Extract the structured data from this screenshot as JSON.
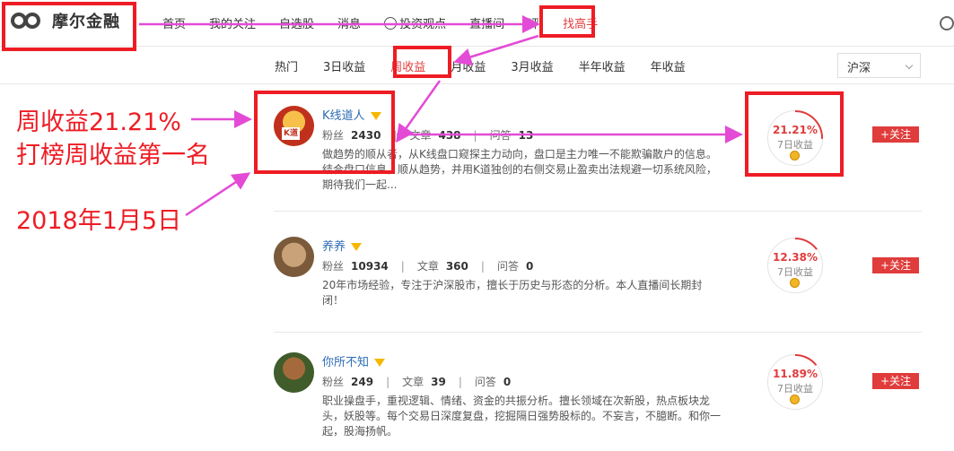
{
  "header": {
    "logo_text": "摩尔金融",
    "nav": [
      {
        "label": "首页"
      },
      {
        "label": "我的关注"
      },
      {
        "label": "自选股"
      },
      {
        "label": "消息"
      },
      {
        "label": "投资观点"
      },
      {
        "label": "直播间"
      },
      {
        "label": "评"
      },
      {
        "label": "找高手"
      }
    ]
  },
  "tabs": {
    "items": [
      "热门",
      "3日收益",
      "周收益",
      "月收益",
      "3月收益",
      "半年收益",
      "年收益"
    ],
    "active_index": 2,
    "market_select": "沪深"
  },
  "experts": [
    {
      "name": "K线道人",
      "fans_label": "粉丝",
      "fans": "2430",
      "articles_label": "文章",
      "articles": "438",
      "qa_label": "问答",
      "qa": "13",
      "bio": "做趋势的顺从者，从K线盘口窥探主力动向，盘口是主力唯一不能欺骗散户的信息。结合盘口信息，顺从趋势，并用K道独创的右侧交易止盈卖出法规避一切系统风险，期待我们一起...",
      "return_pct": "21.21%",
      "return_label": "7日收益",
      "return_value": 0.2121,
      "follow_label": "+关注"
    },
    {
      "name": "养养",
      "fans_label": "粉丝",
      "fans": "10934",
      "articles_label": "文章",
      "articles": "360",
      "qa_label": "问答",
      "qa": "0",
      "bio": "20年市场经验，专注于沪深股市，擅长于历史与形态的分析。本人直播间长期封闭！",
      "return_pct": "12.38%",
      "return_label": "7日收益",
      "return_value": 0.1238,
      "follow_label": "+关注"
    },
    {
      "name": "你所不知",
      "fans_label": "粉丝",
      "fans": "249",
      "articles_label": "文章",
      "articles": "39",
      "qa_label": "问答",
      "qa": "0",
      "bio": "职业操盘手，重视逻辑、情绪、资金的共振分析。擅长领域在次新股，热点板块龙头，妖股等。每个交易日深度复盘，挖掘隔日强势股标的。不妄言，不臆断。和你一起，股海扬帆。",
      "return_pct": "11.89%",
      "return_label": "7日收益",
      "return_value": 0.1189,
      "follow_label": "+关注"
    }
  ],
  "annotations": {
    "line1": "周收益21.21%",
    "line2": "打榜周收益第一名",
    "date": "2018年1月5日"
  },
  "colors": {
    "accent": "#e03c3c",
    "annotation": "#ee1c24",
    "link": "#2e6db4"
  }
}
